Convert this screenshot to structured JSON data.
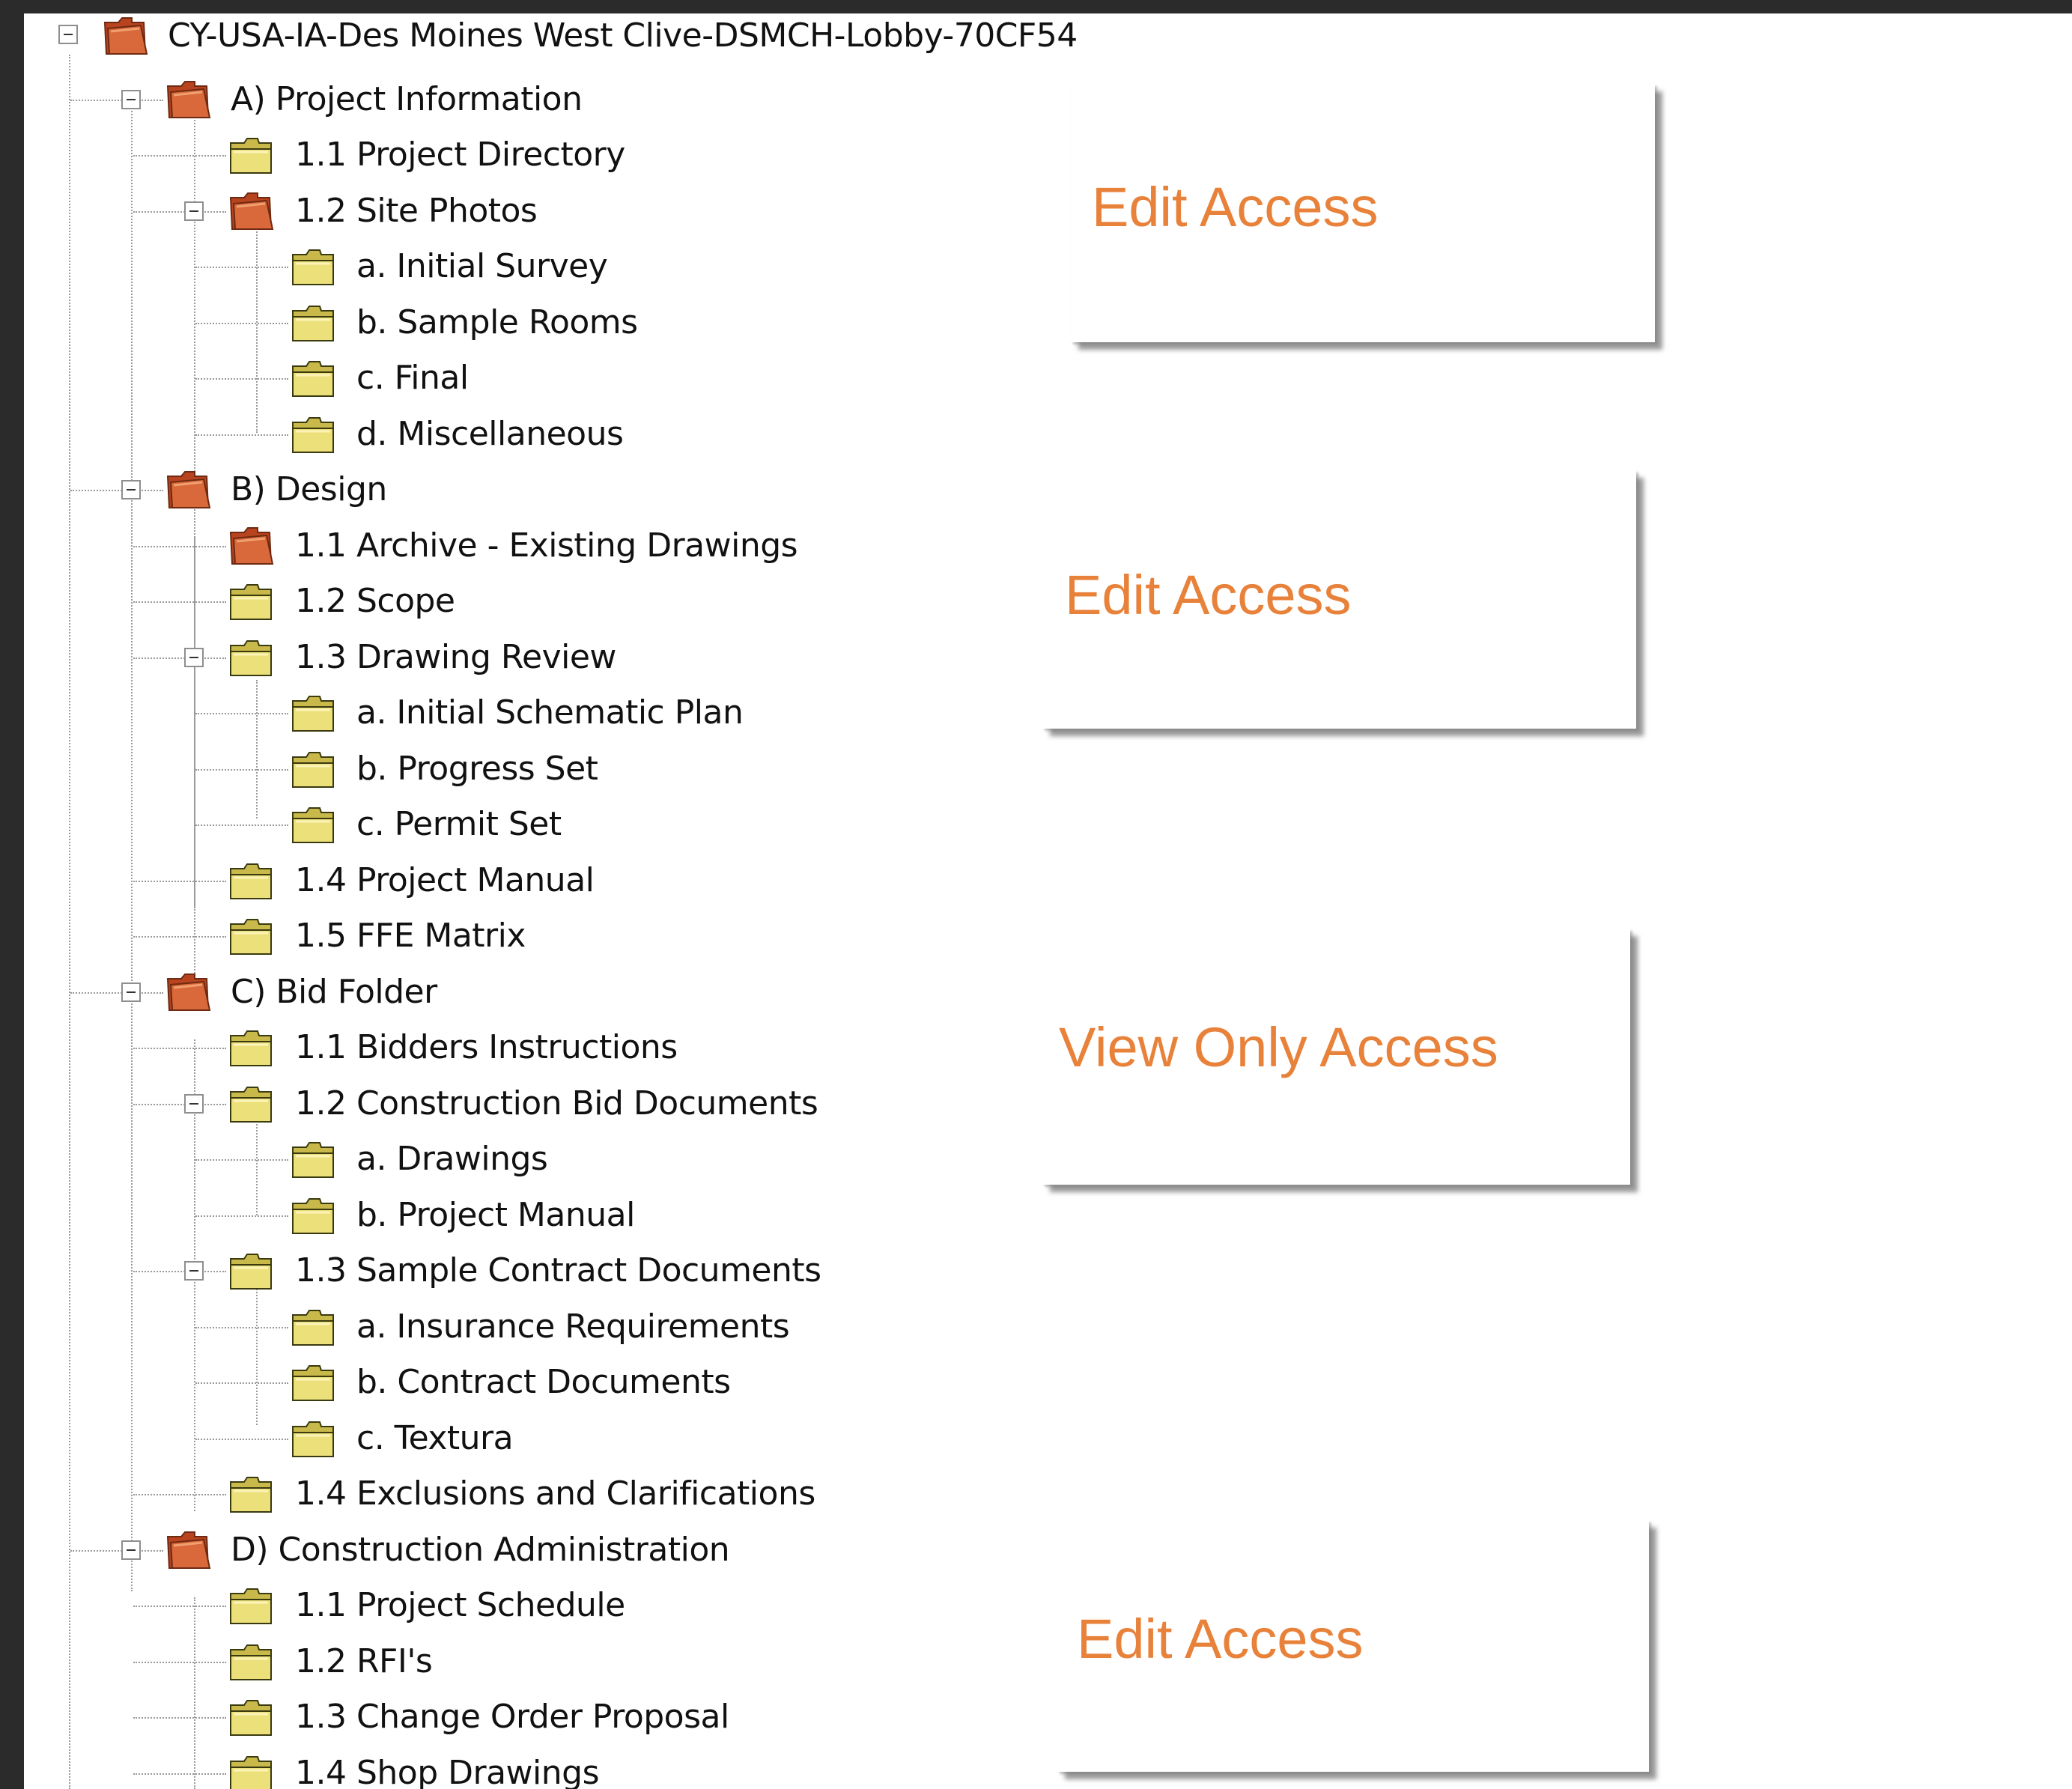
{
  "colors": {
    "access_text": "#e8823a",
    "restricted_folder": "#c8502a",
    "normal_folder": "#e8d97a"
  },
  "tree": {
    "root": {
      "label": "CY-USA-IA-Des Moines West Clive-DSMCH-Lobby-70CF54",
      "icon": "restricted-folder-icon"
    },
    "nodes": [
      {
        "label": "A) Project Information",
        "icon": "restricted-folder-icon"
      },
      {
        "label": "1.1 Project Directory",
        "icon": "folder-icon"
      },
      {
        "label": "1.2 Site Photos",
        "icon": "restricted-folder-icon"
      },
      {
        "label": "a. Initial Survey",
        "icon": "folder-icon"
      },
      {
        "label": "b. Sample Rooms",
        "icon": "folder-icon"
      },
      {
        "label": "c. Final",
        "icon": "folder-icon"
      },
      {
        "label": "d. Miscellaneous",
        "icon": "folder-icon"
      },
      {
        "label": "B) Design",
        "icon": "restricted-folder-icon"
      },
      {
        "label": "1.1 Archive - Existing Drawings",
        "icon": "restricted-folder-icon"
      },
      {
        "label": "1.2 Scope",
        "icon": "folder-icon"
      },
      {
        "label": "1.3 Drawing Review",
        "icon": "folder-icon"
      },
      {
        "label": "a. Initial Schematic Plan",
        "icon": "folder-icon"
      },
      {
        "label": "b. Progress Set",
        "icon": "folder-icon"
      },
      {
        "label": "c. Permit Set",
        "icon": "folder-icon"
      },
      {
        "label": "1.4 Project Manual",
        "icon": "folder-icon"
      },
      {
        "label": "1.5 FFE Matrix",
        "icon": "folder-icon"
      },
      {
        "label": "C) Bid Folder",
        "icon": "restricted-folder-icon"
      },
      {
        "label": "1.1 Bidders Instructions",
        "icon": "folder-icon"
      },
      {
        "label": "1.2 Construction Bid Documents",
        "icon": "folder-icon"
      },
      {
        "label": "a. Drawings",
        "icon": "folder-icon"
      },
      {
        "label": "b. Project Manual",
        "icon": "folder-icon"
      },
      {
        "label": "1.3 Sample Contract Documents",
        "icon": "folder-icon"
      },
      {
        "label": "a. Insurance Requirements",
        "icon": "folder-icon"
      },
      {
        "label": "b. Contract Documents",
        "icon": "folder-icon"
      },
      {
        "label": "c. Textura",
        "icon": "folder-icon"
      },
      {
        "label": "1.4 Exclusions and Clarifications",
        "icon": "folder-icon"
      },
      {
        "label": "D) Construction Administration",
        "icon": "restricted-folder-icon"
      },
      {
        "label": "1.1 Project Schedule",
        "icon": "folder-icon"
      },
      {
        "label": "1.2 RFI's",
        "icon": "folder-icon"
      },
      {
        "label": "1.3 Change Order Proposal",
        "icon": "folder-icon"
      },
      {
        "label": "1.4 Shop Drawings",
        "icon": "folder-icon"
      }
    ]
  },
  "access_cards": [
    {
      "label": "Edit Access"
    },
    {
      "label": "Edit Access"
    },
    {
      "label": "View Only Access"
    },
    {
      "label": "Edit Access"
    }
  ]
}
